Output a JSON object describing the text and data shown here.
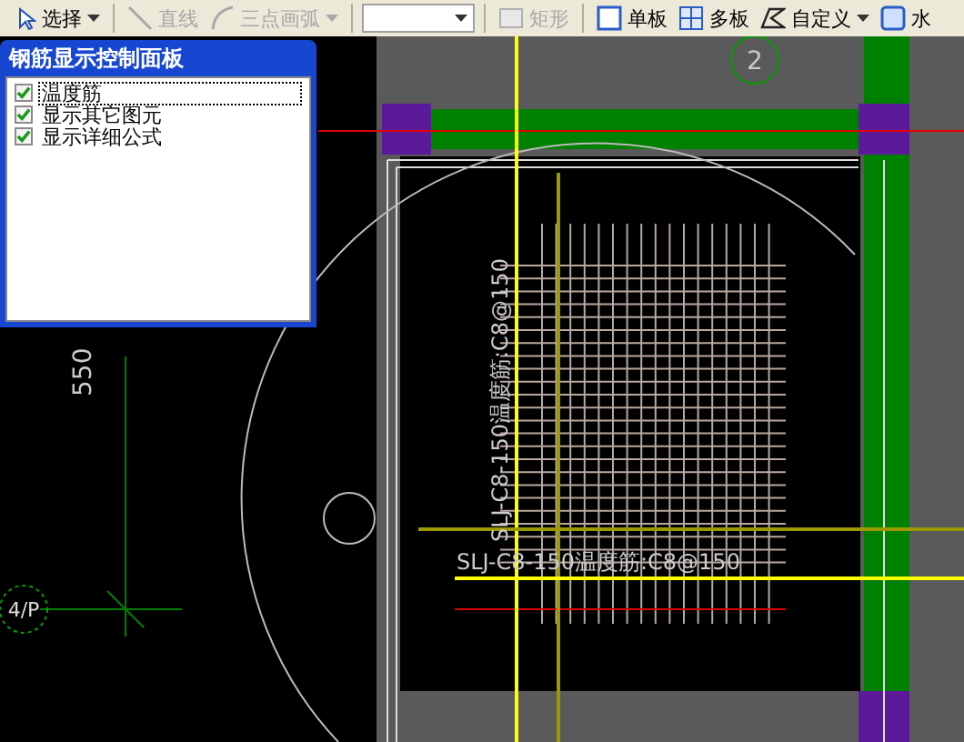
{
  "toolbar": {
    "items": [
      {
        "kind": "button",
        "label": "选择",
        "caret": true,
        "disabled": false
      },
      {
        "kind": "button",
        "label": "直线",
        "caret": false,
        "disabled": true
      },
      {
        "kind": "button",
        "label": "三点画弧",
        "caret": true,
        "disabled": true
      },
      {
        "kind": "combo"
      },
      {
        "kind": "button",
        "label": "矩形",
        "caret": false,
        "disabled": true
      },
      {
        "kind": "button",
        "label": "单板",
        "caret": false,
        "disabled": false
      },
      {
        "kind": "button",
        "label": "多板",
        "caret": false,
        "disabled": false
      },
      {
        "kind": "button",
        "label": "自定义",
        "caret": true,
        "disabled": false
      },
      {
        "kind": "button",
        "label": "水",
        "caret": false,
        "disabled": false
      }
    ]
  },
  "panel": {
    "title": "钢筋显示控制面板",
    "items": [
      {
        "label": "温度筋",
        "checked": true,
        "selected": true
      },
      {
        "label": "显示其它图元",
        "checked": true,
        "selected": false
      },
      {
        "label": "显示详细公式",
        "checked": true,
        "selected": false
      }
    ]
  },
  "drawing": {
    "axis_labels": [
      "2",
      "4/P"
    ],
    "dimension": "550",
    "rebar_labels": [
      {
        "text": "SLJ-C8-150温度筋:C8@150"
      },
      {
        "text": "SLJ-C8-150温度筋:C8@150"
      }
    ]
  }
}
